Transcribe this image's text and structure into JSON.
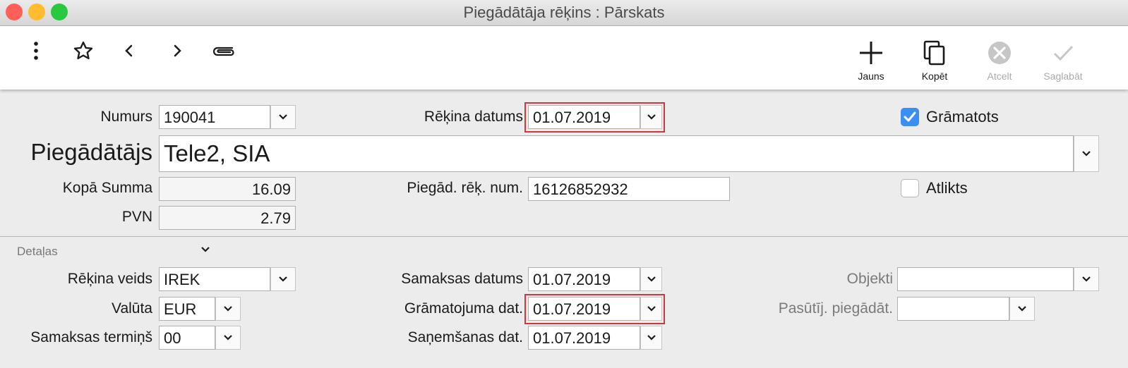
{
  "window": {
    "title": "Piegādātāja rēķins : Pārskats",
    "traffic_lights": {
      "close": "#fe5f57",
      "minimize": "#febc2e",
      "zoom": "#28c840"
    }
  },
  "toolbar": {
    "left_icons": [
      "more-vertical-icon",
      "star-icon",
      "chevron-left-icon",
      "chevron-right-icon",
      "paperclip-icon"
    ],
    "new_label": "Jauns",
    "copy_label": "Kopēt",
    "cancel_label": "Atcelt",
    "save_label": "Saglabāt"
  },
  "header": {
    "number_label": "Numurs",
    "number_value": "190041",
    "invoice_date_label": "Rēķina datums",
    "invoice_date_value": "01.07.2019",
    "posted_label": "Grāmatots",
    "posted_checked": true,
    "supplier_label": "Piegādātājs",
    "supplier_value": "Tele2, SIA",
    "total_label": "Kopā Summa",
    "total_value": "16.09",
    "supplier_invoice_no_label": "Piegād. rēķ. num.",
    "supplier_invoice_no_value": "16126852932",
    "deferred_label": "Atlikts",
    "deferred_checked": false,
    "vat_label": "PVN",
    "vat_value": "2.79"
  },
  "details": {
    "section_label": "Detaļas",
    "invoice_type_label": "Rēķina veids",
    "invoice_type_value": "IREK",
    "currency_label": "Valūta",
    "currency_value": "EUR",
    "payment_term_label": "Samaksas termiņš",
    "payment_term_value": "00",
    "payment_date_label": "Samaksas datums",
    "payment_date_value": "01.07.2019",
    "posting_date_label": "Grāmatojuma dat.",
    "posting_date_value": "01.07.2019",
    "received_date_label": "Saņemšanas dat.",
    "received_date_value": "01.07.2019",
    "objects_label": "Objekti",
    "objects_value": "",
    "order_supplier_label": "Pasūtīj. piegādāt.",
    "order_supplier_value": ""
  },
  "colors": {
    "highlight_border": "#d0373b",
    "checkbox_checked": "#3b8ff4",
    "disabled_text": "#aaaaaa"
  }
}
